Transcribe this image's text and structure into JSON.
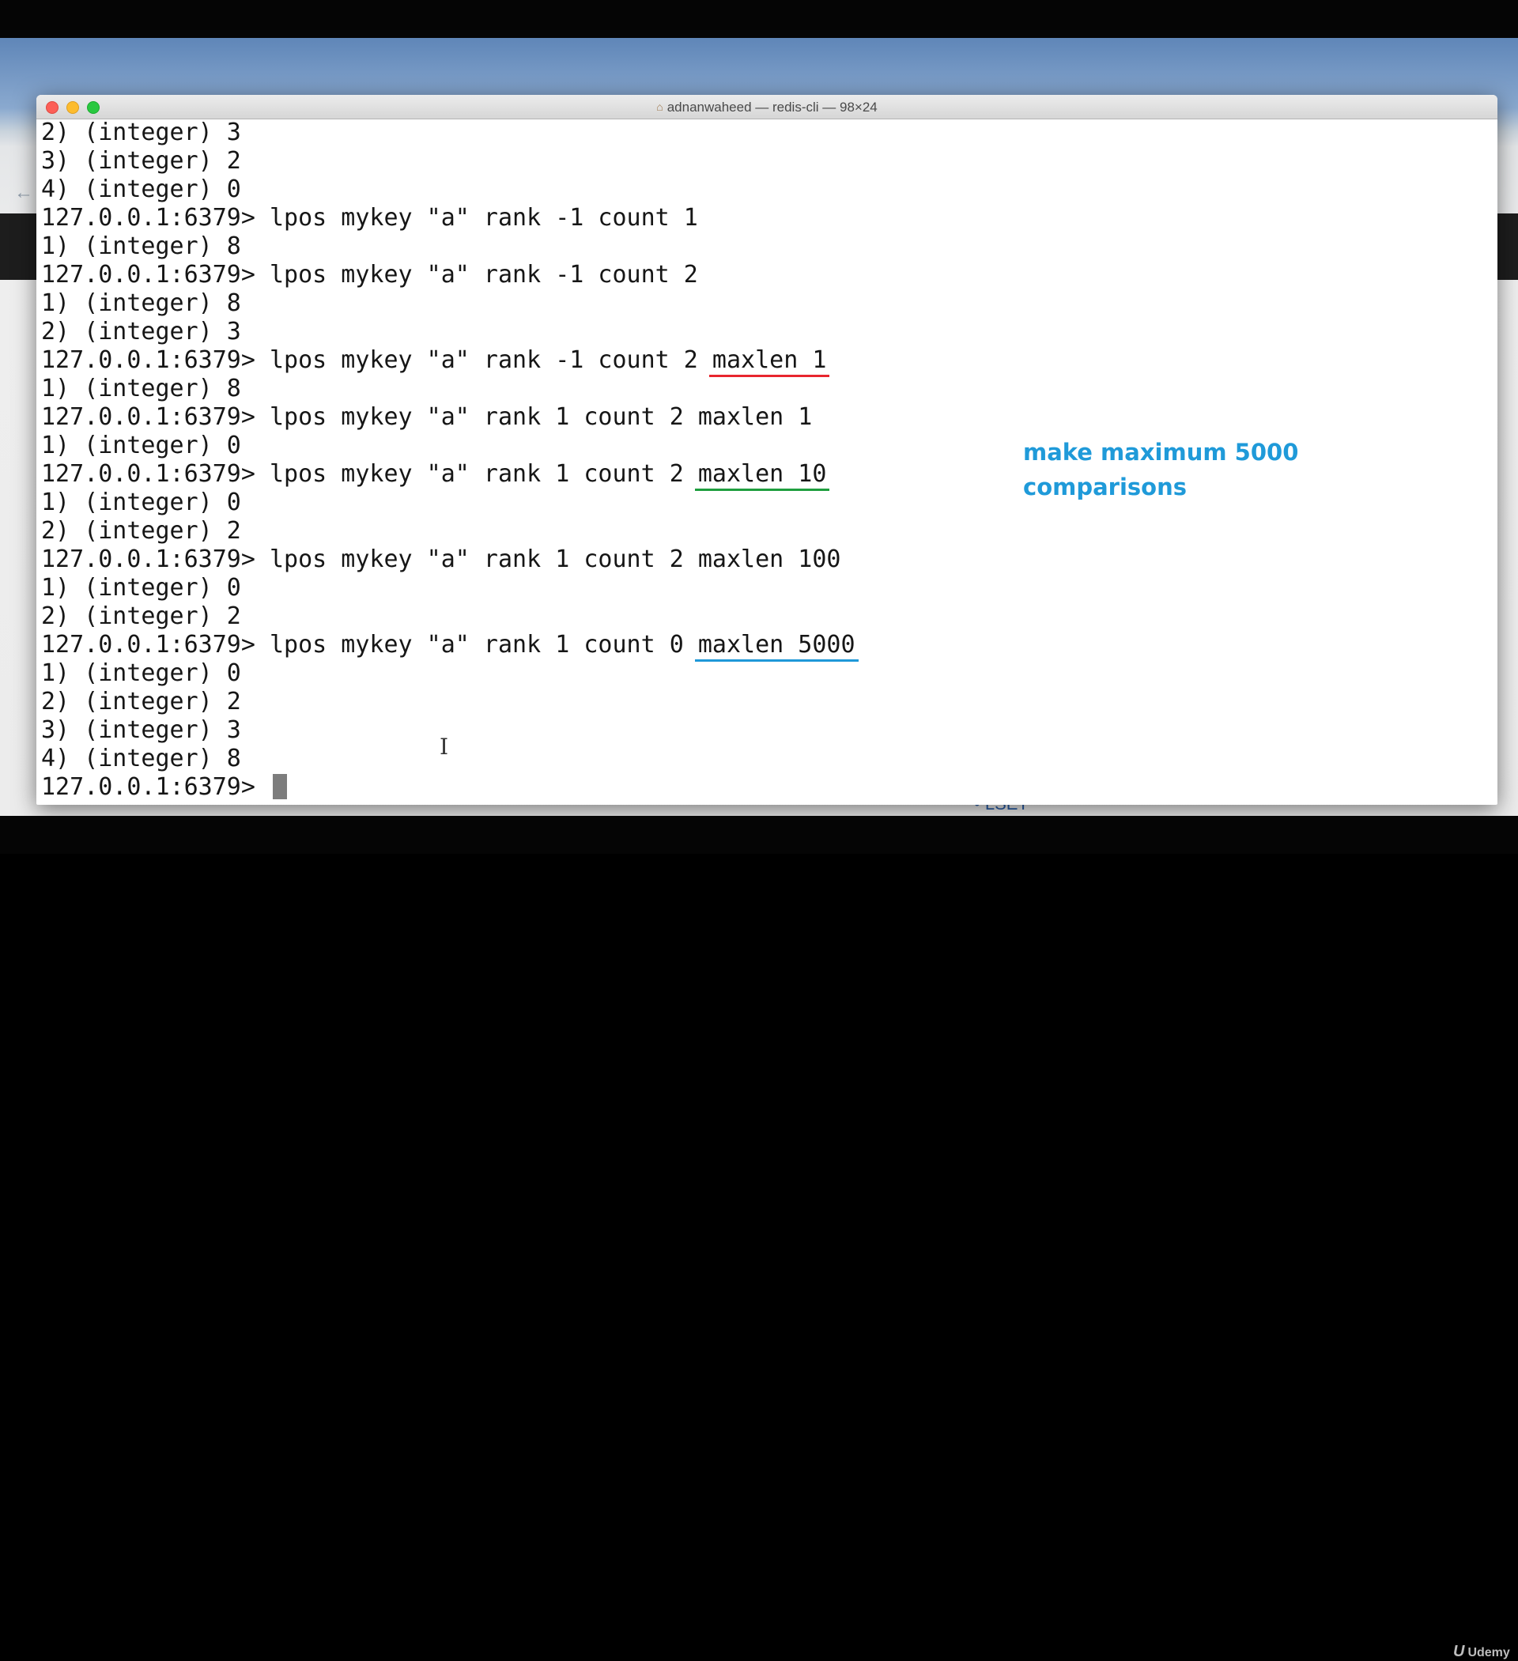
{
  "window": {
    "title": "adnanwaheed — redis-cli — 98×24",
    "title_icon": "home-icon"
  },
  "terminal": {
    "lines": [
      {
        "text": "2) (integer) 3"
      },
      {
        "text": "3) (integer) 2"
      },
      {
        "text": "4) (integer) 0"
      },
      {
        "text": "127.0.0.1:6379> lpos mykey \"a\" rank -1 count 1"
      },
      {
        "text": "1) (integer) 8"
      },
      {
        "text": "127.0.0.1:6379> lpos mykey \"a\" rank -1 count 2"
      },
      {
        "text": "1) (integer) 8"
      },
      {
        "text": "2) (integer) 3"
      },
      {
        "text": "127.0.0.1:6379> lpos mykey \"a\" rank -1 count 2 ",
        "hl": "maxlen 1",
        "hl_color": "red"
      },
      {
        "text": "1) (integer) 8"
      },
      {
        "text": "127.0.0.1:6379> lpos mykey \"a\" rank 1 count 2 maxlen 1"
      },
      {
        "text": "1) (integer) 0"
      },
      {
        "text": "127.0.0.1:6379> lpos mykey \"a\" rank 1 count 2 ",
        "hl": "maxlen 10",
        "hl_color": "green"
      },
      {
        "text": "1) (integer) 0"
      },
      {
        "text": "2) (integer) 2"
      },
      {
        "text": "127.0.0.1:6379> lpos mykey \"a\" rank 1 count 2 maxlen 100"
      },
      {
        "text": "1) (integer) 0"
      },
      {
        "text": "2) (integer) 2"
      },
      {
        "text": "127.0.0.1:6379> lpos mykey \"a\" rank 1 count 0 ",
        "hl": "maxlen 5000",
        "hl_color": "blue"
      },
      {
        "text": "1) (integer) 0"
      },
      {
        "text": "2) (integer) 2"
      },
      {
        "text": "3) (integer) 3"
      },
      {
        "text": "4) (integer) 8"
      },
      {
        "text": "127.0.0.1:6379> ",
        "cursor": true
      }
    ]
  },
  "annotation": {
    "line1": "make maximum 5000",
    "line2": "comparisons",
    "color": "#1f9ad9"
  },
  "underline_colors": {
    "red": "#e8262e",
    "green": "#1f9e3f",
    "blue": "#1f98d8"
  },
  "background": {
    "lset_text": "LSET",
    "watermark": "Udemy"
  }
}
